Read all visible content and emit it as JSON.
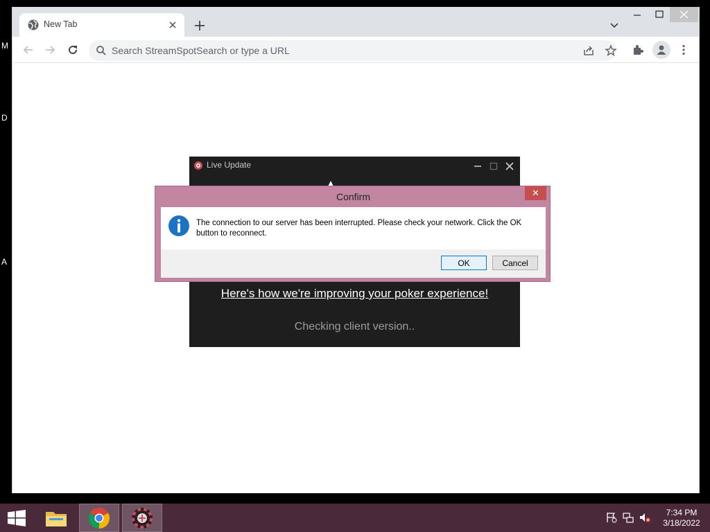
{
  "desktop": {
    "letters": [
      "M",
      "D",
      "A"
    ]
  },
  "browser": {
    "tab_title": "New Tab",
    "omnibox_placeholder": "Search StreamSpotSearch or type a URL"
  },
  "live_update": {
    "title": "Live Update",
    "improve_link": "Here's how we're improving your poker experience!",
    "status": "Checking client version.."
  },
  "confirm": {
    "title": "Confirm",
    "close_glyph": "✕",
    "message_line1": "The connection to our server has been interrupted. Please check your network. Click the OK",
    "message_line2": "button to reconnect.",
    "ok_label": "OK",
    "cancel_label": "Cancel"
  },
  "taskbar": {
    "time": "7:34 PM",
    "date": "3/18/2022"
  },
  "colors": {
    "confirm_border": "#c286a2",
    "taskbar": "#4a2a3a",
    "info_blue": "#1c73c4"
  }
}
